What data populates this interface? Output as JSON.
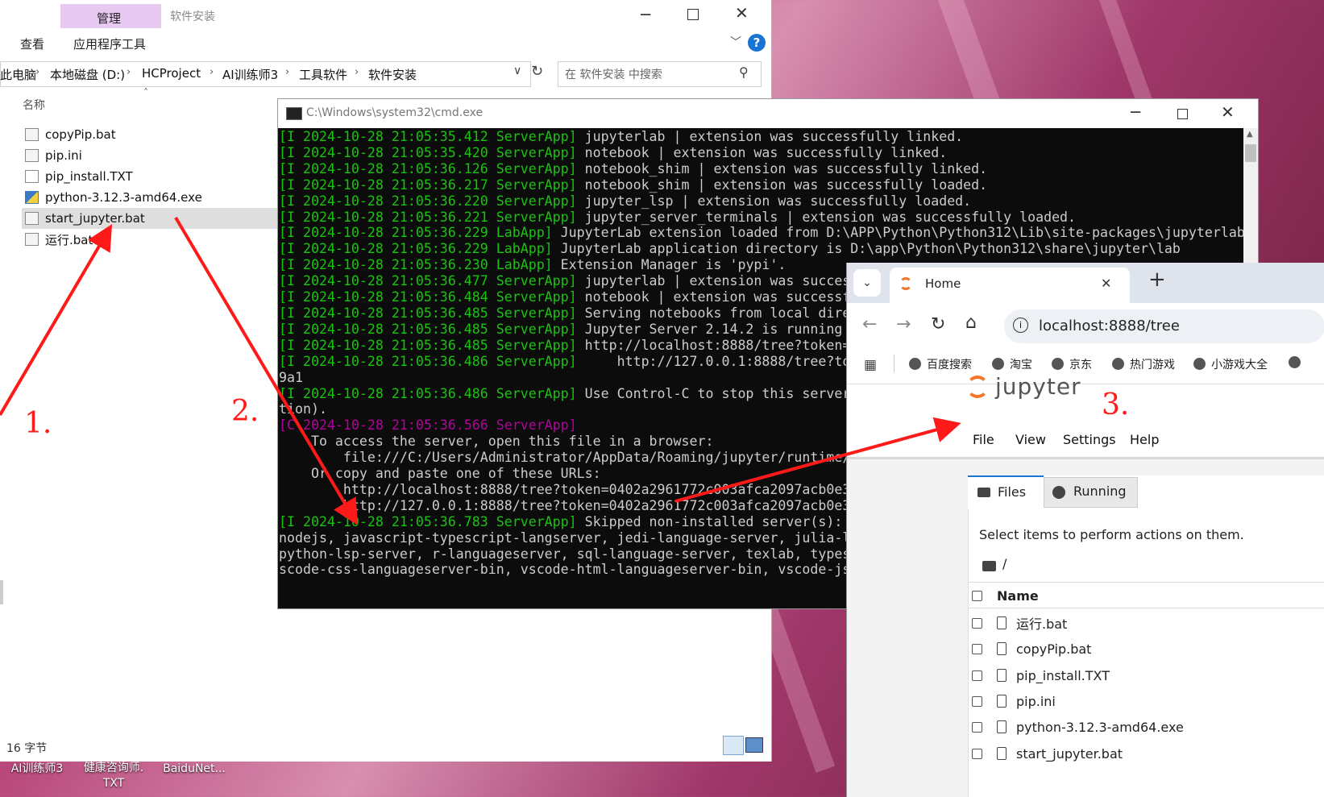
{
  "explorer": {
    "tab_manage": "管理",
    "tab_view": "查看",
    "tab_app_tools": "应用程序工具",
    "window_title": "软件安装",
    "breadcrumb": [
      "此电脑",
      "本地磁盘 (D:)",
      "HCProject",
      "AI训练师3",
      "工具软件",
      "软件安装"
    ],
    "search_placeholder": "在 软件安装 中搜索",
    "column_name": "名称",
    "files": [
      "copyPip.bat",
      "pip.ini",
      "pip_install.TXT",
      "python-3.12.3-amd64.exe",
      "start_jupyter.bat",
      "运行.bat"
    ],
    "selected_file": "start_jupyter.bat",
    "status": "16 字节"
  },
  "desktop": {
    "icons": [
      "AI训练师3",
      "健康咨询师.\nTXT",
      "BaiduNet..."
    ]
  },
  "cmd": {
    "title": "C:\\Windows\\system32\\cmd.exe",
    "lines": [
      {
        "p": "[I 2024-10-28 21:05:35.412 ServerApp]",
        "t": " jupyterlab | extension was successfully linked."
      },
      {
        "p": "[I 2024-10-28 21:05:35.420 ServerApp]",
        "t": " notebook | extension was successfully linked."
      },
      {
        "p": "[I 2024-10-28 21:05:36.126 ServerApp]",
        "t": " notebook_shim | extension was successfully linked."
      },
      {
        "p": "[I 2024-10-28 21:05:36.217 ServerApp]",
        "t": " notebook_shim | extension was successfully loaded."
      },
      {
        "p": "[I 2024-10-28 21:05:36.220 ServerApp]",
        "t": " jupyter_lsp | extension was successfully loaded."
      },
      {
        "p": "[I 2024-10-28 21:05:36.221 ServerApp]",
        "t": " jupyter_server_terminals | extension was successfully loaded."
      },
      {
        "p": "[I 2024-10-28 21:05:36.229 LabApp]",
        "t": " JupyterLab extension loaded from D:\\APP\\Python\\Python312\\Lib\\site-packages\\jupyterlab"
      },
      {
        "p": "[I 2024-10-28 21:05:36.229 LabApp]",
        "t": " JupyterLab application directory is D:\\app\\Python\\Python312\\share\\jupyter\\lab"
      },
      {
        "p": "[I 2024-10-28 21:05:36.230 LabApp]",
        "t": " Extension Manager is 'pypi'."
      },
      {
        "p": "[I 2024-10-28 21:05:36.477 ServerApp]",
        "t": " jupyterlab | extension was succes"
      },
      {
        "p": "[I 2024-10-28 21:05:36.484 ServerApp]",
        "t": " notebook | extension was successf"
      },
      {
        "p": "[I 2024-10-28 21:05:36.485 ServerApp]",
        "t": " Serving notebooks from local dire"
      },
      {
        "p": "[I 2024-10-28 21:05:36.485 ServerApp]",
        "t": " Jupyter Server 2.14.2 is running"
      },
      {
        "p": "[I 2024-10-28 21:05:36.485 ServerApp]",
        "t": " http://localhost:8888/tree?token="
      },
      {
        "p": "[I 2024-10-28 21:05:36.486 ServerApp]",
        "t": "     http://127.0.0.1:8888/tree?to"
      },
      {
        "p": "",
        "t": "9a1"
      },
      {
        "p": "[I 2024-10-28 21:05:36.486 ServerApp]",
        "t": " Use Control-C to stop this server"
      },
      {
        "p": "",
        "t": "tion)."
      },
      {
        "p": "[C 2024-10-28 21:05:36.566 ServerApp]",
        "t": "",
        "c": "m"
      },
      {
        "p": "",
        "t": ""
      },
      {
        "p": "",
        "t": "    To access the server, open this file in a browser:"
      },
      {
        "p": "",
        "t": "        file:///C:/Users/Administrator/AppData/Roaming/jupyter/runtime/"
      },
      {
        "p": "",
        "t": "    Or copy and paste one of these URLs:"
      },
      {
        "p": "",
        "t": "        http://localhost:8888/tree?token=0402a2961772c003afca2097acb0e3"
      },
      {
        "p": "",
        "t": "        http://127.0.0.1:8888/tree?token=0402a2961772c003afca2097acb0e3"
      },
      {
        "p": "[I 2024-10-28 21:05:36.783 ServerApp]",
        "t": " Skipped non-installed server(s):"
      },
      {
        "p": "",
        "t": "nodejs, javascript-typescript-langserver, jedi-language-server, julia-l"
      },
      {
        "p": "",
        "t": "python-lsp-server, r-languageserver, sql-language-server, texlab, types"
      },
      {
        "p": "",
        "t": "scode-css-languageserver-bin, vscode-html-languageserver-bin, vscode-js"
      }
    ]
  },
  "browser": {
    "tab_title": "Home",
    "url": "localhost:8888/tree",
    "bookmarks": [
      "百度搜索",
      "淘宝",
      "京东",
      "热门游戏",
      "小游戏大全"
    ],
    "brand": "jupyter",
    "menu": [
      "File",
      "View",
      "Settings",
      "Help"
    ],
    "side_tabs": [
      "Files",
      "Running"
    ],
    "hint": "Select items to perform actions on them.",
    "path": "/",
    "col_name": "Name",
    "files": [
      "运行.bat",
      "copyPip.bat",
      "pip_install.TXT",
      "pip.ini",
      "python-3.12.3-amd64.exe",
      "start_jupyter.bat"
    ]
  },
  "annotations": [
    "1.",
    "2.",
    "3."
  ],
  "colors": {
    "arrow": "#ff1a1a",
    "jupyter_orange": "#f37726",
    "cmd_green": "#16c60c",
    "cmd_magenta": "#b4009e"
  }
}
